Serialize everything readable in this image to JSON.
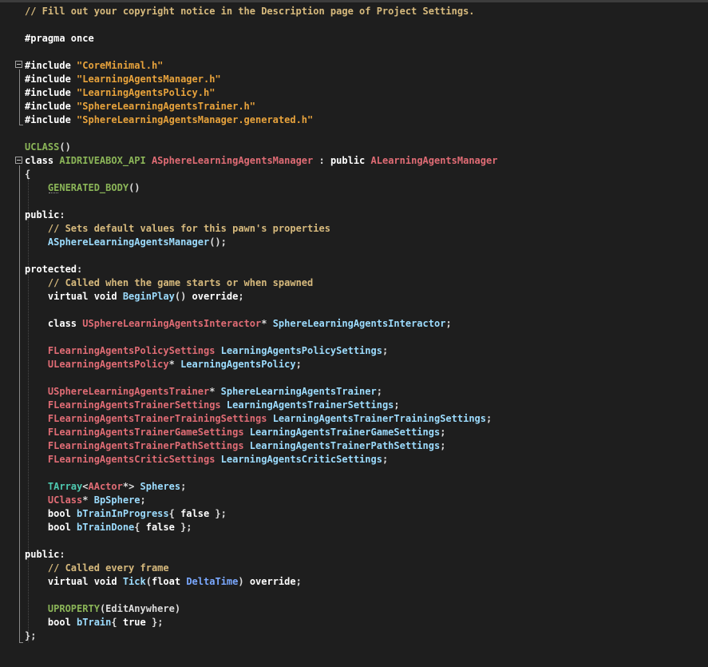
{
  "colors": {
    "background": "#1e1e1e",
    "plain": "#dcdcdc",
    "keyword": "#ffffff",
    "comment": "#57a64a",
    "comment_text": "#d7ba7d",
    "string": "#e8a33c",
    "macro": "#8bb558",
    "class_name": "#e06c75",
    "member": "#9cdcfe",
    "parameter": "#7aa8ff",
    "type": "#4ec9b0"
  },
  "editor": {
    "lines": [
      [
        {
          "t": "// Fill out your copyright notice in the Description page of Project Settings.",
          "c": "comment_text"
        }
      ],
      [],
      [
        {
          "t": "#pragma once",
          "c": "keyword"
        }
      ],
      [],
      [
        {
          "t": "#include ",
          "c": "keyword"
        },
        {
          "t": "\"CoreMinimal.h\"",
          "c": "string"
        }
      ],
      [
        {
          "t": "#include ",
          "c": "keyword"
        },
        {
          "t": "\"LearningAgentsManager.h\"",
          "c": "string"
        }
      ],
      [
        {
          "t": "#include ",
          "c": "keyword"
        },
        {
          "t": "\"LearningAgentsPolicy.h\"",
          "c": "string"
        }
      ],
      [
        {
          "t": "#include ",
          "c": "keyword"
        },
        {
          "t": "\"SphereLearningAgentsTrainer.h\"",
          "c": "string"
        }
      ],
      [
        {
          "t": "#include ",
          "c": "keyword"
        },
        {
          "t": "\"SphereLearningAgentsManager.generated.h\"",
          "c": "string"
        }
      ],
      [],
      [
        {
          "t": "UCLASS",
          "c": "macro"
        },
        {
          "t": "()",
          "c": "plain"
        }
      ],
      [
        {
          "t": "class ",
          "c": "keyword"
        },
        {
          "t": "AIDRIVEABOX_API ",
          "c": "macro"
        },
        {
          "t": "ASphereLearningAgentsManager",
          "c": "class_name"
        },
        {
          "t": " : ",
          "c": "plain"
        },
        {
          "t": "public ",
          "c": "keyword"
        },
        {
          "t": "ALearningAgentsManager",
          "c": "class_name"
        }
      ],
      [
        {
          "t": "{",
          "c": "plain"
        }
      ],
      [
        {
          "t": "    ",
          "c": "plain"
        },
        {
          "t": "GENERATED_BODY",
          "c": "macro"
        },
        {
          "t": "()",
          "c": "plain"
        }
      ],
      [],
      [
        {
          "t": "public",
          "c": "keyword"
        },
        {
          "t": ":",
          "c": "plain"
        }
      ],
      [
        {
          "t": "    ",
          "c": "plain"
        },
        {
          "t": "// Sets default values for this pawn's properties",
          "c": "comment_text"
        }
      ],
      [
        {
          "t": "    ",
          "c": "plain"
        },
        {
          "t": "ASphereLearningAgentsManager",
          "c": "member"
        },
        {
          "t": "();",
          "c": "plain"
        }
      ],
      [],
      [
        {
          "t": "protected",
          "c": "keyword"
        },
        {
          "t": ":",
          "c": "plain"
        }
      ],
      [
        {
          "t": "    ",
          "c": "plain"
        },
        {
          "t": "// Called when the game starts or when spawned",
          "c": "comment_text"
        }
      ],
      [
        {
          "t": "    ",
          "c": "plain"
        },
        {
          "t": "virtual void ",
          "c": "keyword"
        },
        {
          "t": "BeginPlay",
          "c": "member"
        },
        {
          "t": "() ",
          "c": "plain"
        },
        {
          "t": "override",
          "c": "keyword"
        },
        {
          "t": ";",
          "c": "plain"
        }
      ],
      [],
      [
        {
          "t": "    ",
          "c": "plain"
        },
        {
          "t": "class ",
          "c": "keyword"
        },
        {
          "t": "USphereLearningAgentsInteractor",
          "c": "class_name"
        },
        {
          "t": "* ",
          "c": "plain"
        },
        {
          "t": "SphereLearningAgentsInteractor",
          "c": "member"
        },
        {
          "t": ";",
          "c": "plain"
        }
      ],
      [],
      [
        {
          "t": "    ",
          "c": "plain"
        },
        {
          "t": "FLearningAgentsPolicySettings",
          "c": "class_name"
        },
        {
          "t": " ",
          "c": "plain"
        },
        {
          "t": "LearningAgentsPolicySettings",
          "c": "member"
        },
        {
          "t": ";",
          "c": "plain"
        }
      ],
      [
        {
          "t": "    ",
          "c": "plain"
        },
        {
          "t": "ULearningAgentsPolicy",
          "c": "class_name"
        },
        {
          "t": "* ",
          "c": "plain"
        },
        {
          "t": "LearningAgentsPolicy",
          "c": "member"
        },
        {
          "t": ";",
          "c": "plain"
        }
      ],
      [],
      [
        {
          "t": "    ",
          "c": "plain"
        },
        {
          "t": "USphereLearningAgentsTrainer",
          "c": "class_name"
        },
        {
          "t": "* ",
          "c": "plain"
        },
        {
          "t": "SphereLearningAgentsTrainer",
          "c": "member"
        },
        {
          "t": ";",
          "c": "plain"
        }
      ],
      [
        {
          "t": "    ",
          "c": "plain"
        },
        {
          "t": "FLearningAgentsTrainerSettings",
          "c": "class_name"
        },
        {
          "t": " ",
          "c": "plain"
        },
        {
          "t": "LearningAgentsTrainerSettings",
          "c": "member"
        },
        {
          "t": ";",
          "c": "plain"
        }
      ],
      [
        {
          "t": "    ",
          "c": "plain"
        },
        {
          "t": "FLearningAgentsTrainerTrainingSettings",
          "c": "class_name"
        },
        {
          "t": " ",
          "c": "plain"
        },
        {
          "t": "LearningAgentsTrainerTrainingSettings",
          "c": "member"
        },
        {
          "t": ";",
          "c": "plain"
        }
      ],
      [
        {
          "t": "    ",
          "c": "plain"
        },
        {
          "t": "FLearningAgentsTrainerGameSettings",
          "c": "class_name"
        },
        {
          "t": " ",
          "c": "plain"
        },
        {
          "t": "LearningAgentsTrainerGameSettings",
          "c": "member"
        },
        {
          "t": ";",
          "c": "plain"
        }
      ],
      [
        {
          "t": "    ",
          "c": "plain"
        },
        {
          "t": "FLearningAgentsTrainerPathSettings",
          "c": "class_name"
        },
        {
          "t": " ",
          "c": "plain"
        },
        {
          "t": "LearningAgentsTrainerPathSettings",
          "c": "member"
        },
        {
          "t": ";",
          "c": "plain"
        }
      ],
      [
        {
          "t": "    ",
          "c": "plain"
        },
        {
          "t": "FLearningAgentsCriticSettings",
          "c": "class_name"
        },
        {
          "t": " ",
          "c": "plain"
        },
        {
          "t": "LearningAgentsCriticSettings",
          "c": "member"
        },
        {
          "t": ";",
          "c": "plain"
        }
      ],
      [],
      [
        {
          "t": "    ",
          "c": "plain"
        },
        {
          "t": "TArray",
          "c": "type"
        },
        {
          "t": "<",
          "c": "plain"
        },
        {
          "t": "AActor",
          "c": "class_name"
        },
        {
          "t": "*> ",
          "c": "plain"
        },
        {
          "t": "Spheres",
          "c": "member"
        },
        {
          "t": ";",
          "c": "plain"
        }
      ],
      [
        {
          "t": "    ",
          "c": "plain"
        },
        {
          "t": "UClass",
          "c": "class_name"
        },
        {
          "t": "* ",
          "c": "plain"
        },
        {
          "t": "BpSphere",
          "c": "member"
        },
        {
          "t": ";",
          "c": "plain"
        }
      ],
      [
        {
          "t": "    ",
          "c": "plain"
        },
        {
          "t": "bool ",
          "c": "keyword"
        },
        {
          "t": "bTrainInProgress",
          "c": "member"
        },
        {
          "t": "{ ",
          "c": "plain"
        },
        {
          "t": "false",
          "c": "keyword"
        },
        {
          "t": " };",
          "c": "plain"
        }
      ],
      [
        {
          "t": "    ",
          "c": "plain"
        },
        {
          "t": "bool ",
          "c": "keyword"
        },
        {
          "t": "bTrainDone",
          "c": "member"
        },
        {
          "t": "{ ",
          "c": "plain"
        },
        {
          "t": "false",
          "c": "keyword"
        },
        {
          "t": " };",
          "c": "plain"
        }
      ],
      [],
      [
        {
          "t": "public",
          "c": "keyword"
        },
        {
          "t": ":",
          "c": "plain"
        }
      ],
      [
        {
          "t": "    ",
          "c": "plain"
        },
        {
          "t": "// Called every frame",
          "c": "comment_text"
        }
      ],
      [
        {
          "t": "    ",
          "c": "plain"
        },
        {
          "t": "virtual void ",
          "c": "keyword"
        },
        {
          "t": "Tick",
          "c": "member"
        },
        {
          "t": "(",
          "c": "plain"
        },
        {
          "t": "float ",
          "c": "keyword"
        },
        {
          "t": "DeltaTime",
          "c": "parameter"
        },
        {
          "t": ") ",
          "c": "plain"
        },
        {
          "t": "override",
          "c": "keyword"
        },
        {
          "t": ";",
          "c": "plain"
        }
      ],
      [],
      [
        {
          "t": "    ",
          "c": "plain"
        },
        {
          "t": "UPROPERTY",
          "c": "macro"
        },
        {
          "t": "(EditAnywhere)",
          "c": "plain"
        }
      ],
      [
        {
          "t": "    ",
          "c": "plain"
        },
        {
          "t": "bool ",
          "c": "keyword"
        },
        {
          "t": "bTrain",
          "c": "member"
        },
        {
          "t": "{ ",
          "c": "plain"
        },
        {
          "t": "true",
          "c": "keyword"
        },
        {
          "t": " };",
          "c": "plain"
        }
      ],
      [
        {
          "t": "};",
          "c": "plain"
        }
      ]
    ]
  }
}
